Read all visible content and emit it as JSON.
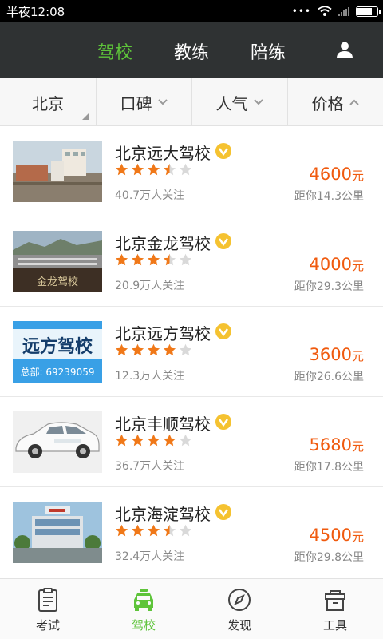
{
  "status_bar": {
    "time": "半夜12:08",
    "dots": "•••"
  },
  "top_nav": {
    "tabs": [
      {
        "label": "驾校",
        "active": true
      },
      {
        "label": "教练",
        "active": false
      },
      {
        "label": "陪练",
        "active": false
      }
    ],
    "user_icon": "user-icon"
  },
  "filter_bar": {
    "city": "北京",
    "items": [
      {
        "label": "口碑",
        "arrow": "chevron-down-icon"
      },
      {
        "label": "人气",
        "arrow": "chevron-down-icon"
      },
      {
        "label": "价格",
        "arrow": "chevron-up-icon"
      }
    ]
  },
  "schools": [
    {
      "name": "北京远大驾校",
      "rating": 3.5,
      "followers": "40.7万人关注",
      "price": "4600",
      "unit": "元",
      "distance": "距你14.3公里"
    },
    {
      "name": "北京金龙驾校",
      "rating": 3.5,
      "followers": "20.9万人关注",
      "price": "4000",
      "unit": "元",
      "distance": "距你29.3公里",
      "thumb_text": "金龙驾校"
    },
    {
      "name": "北京远方驾校",
      "rating": 4,
      "followers": "12.3万人关注",
      "price": "3600",
      "unit": "元",
      "distance": "距你26.6公里",
      "thumb_title": "远方驾校",
      "thumb_sub": "总部: 69239059"
    },
    {
      "name": "北京丰顺驾校",
      "rating": 4,
      "followers": "36.7万人关注",
      "price": "5680",
      "unit": "元",
      "distance": "距你17.8公里"
    },
    {
      "name": "北京海淀驾校",
      "rating": 3.5,
      "followers": "32.4万人关注",
      "price": "4500",
      "unit": "元",
      "distance": "距你29.8公里"
    }
  ],
  "tab_bar": {
    "tabs": [
      {
        "label": "考试",
        "icon": "clipboard-icon",
        "active": false
      },
      {
        "label": "驾校",
        "icon": "car-icon",
        "active": true
      },
      {
        "label": "发现",
        "icon": "compass-icon",
        "active": false
      },
      {
        "label": "工具",
        "icon": "toolbox-icon",
        "active": false
      }
    ]
  },
  "colors": {
    "accent_green": "#5ec43a",
    "price_orange": "#f05a0e",
    "star_orange": "#f07818",
    "badge_yellow": "#f5c230",
    "nav_bg": "#2f3233"
  }
}
